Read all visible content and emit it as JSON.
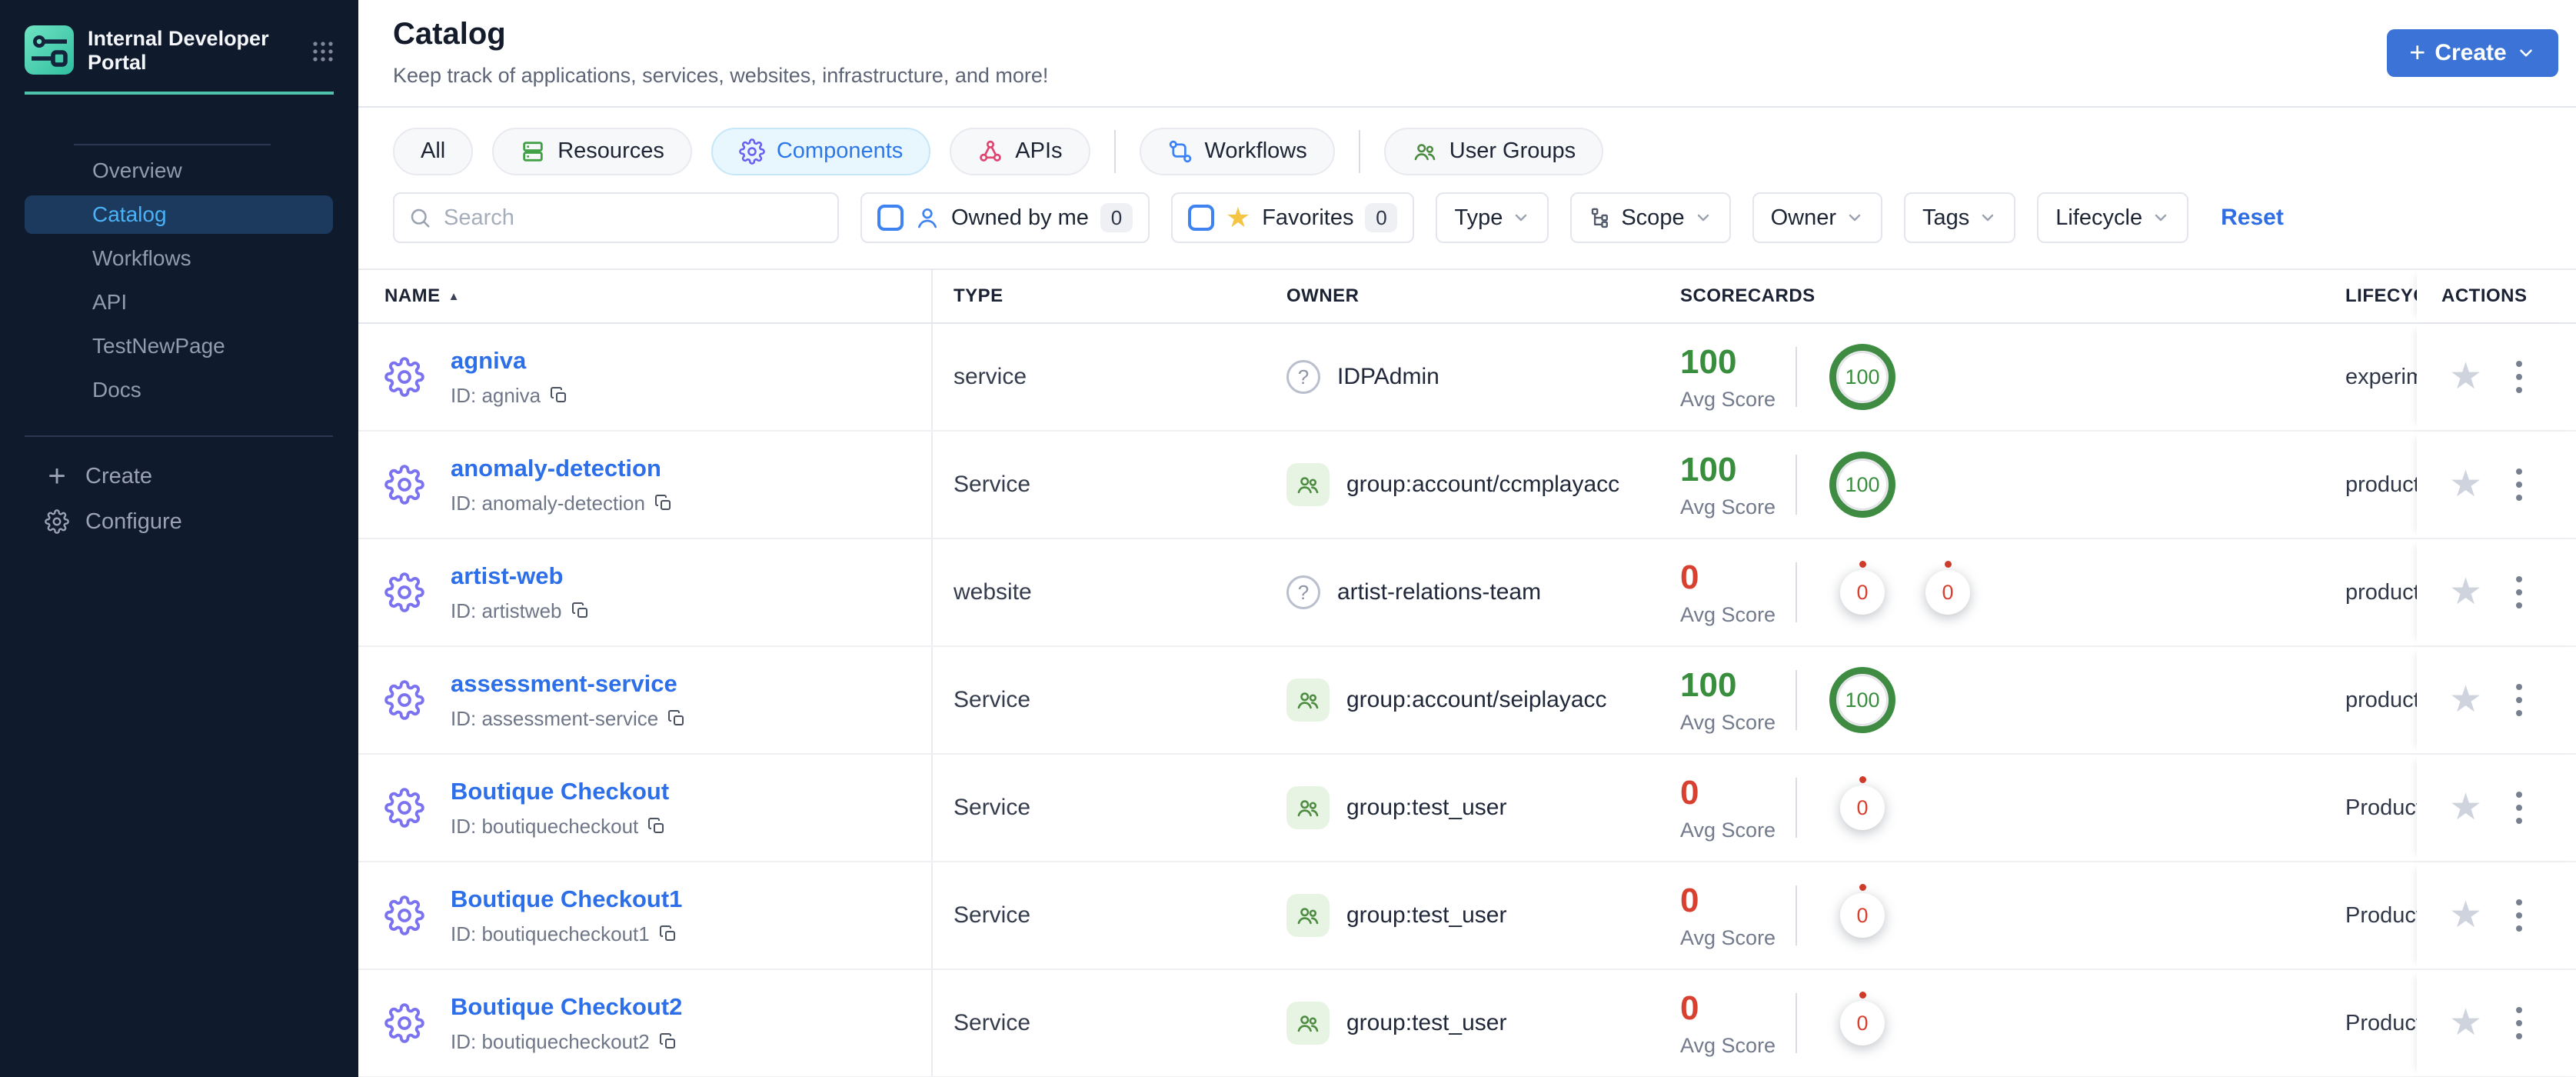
{
  "sidebar": {
    "brand_title": "Internal Developer Portal",
    "nav": {
      "overview": "Overview",
      "catalog": "Catalog",
      "workflows": "Workflows",
      "api": "API",
      "testnewpage": "TestNewPage",
      "docs": "Docs"
    },
    "active_item": "Catalog",
    "create_label": "Create",
    "configure_label": "Configure"
  },
  "header": {
    "title": "Catalog",
    "subtitle": "Keep track of applications, services, websites, infrastructure, and more!",
    "create_button": "Create"
  },
  "tabs": {
    "all": "All",
    "resources": "Resources",
    "components": "Components",
    "apis": "APIs",
    "workflows": "Workflows",
    "user_groups": "User Groups",
    "active_tab": "Components"
  },
  "filters": {
    "search_placeholder": "Search",
    "owned_by_me": {
      "label": "Owned by me",
      "count": "0",
      "checked": false
    },
    "favorites": {
      "label": "Favorites",
      "count": "0",
      "checked": false
    },
    "type_label": "Type",
    "scope_label": "Scope",
    "owner_label": "Owner",
    "tags_label": "Tags",
    "lifecycle_label": "Lifecycle",
    "reset_label": "Reset"
  },
  "table": {
    "headers": {
      "name": "NAME",
      "type": "TYPE",
      "owner": "OWNER",
      "scorecards": "SCORECARDS",
      "lifecycle": "LIFECYCLE",
      "actions": "ACTIONS"
    },
    "sort": {
      "column": "NAME",
      "direction": "ascending"
    },
    "avg_score_label": "Avg Score",
    "rows": [
      {
        "name": "agniva",
        "id_label": "ID: agniva",
        "type": "service",
        "owner": "IDPAdmin",
        "owner_kind": "user",
        "avg_score": "100",
        "score_state": "good",
        "scorecards": [
          "100"
        ],
        "lifecycle": "experimental"
      },
      {
        "name": "anomaly-detection",
        "id_label": "ID: anomaly-detection",
        "type": "Service",
        "owner": "group:account/ccmplayacc",
        "owner_kind": "group",
        "avg_score": "100",
        "score_state": "good",
        "scorecards": [
          "100"
        ],
        "lifecycle": "production"
      },
      {
        "name": "artist-web",
        "id_label": "ID: artistweb",
        "type": "website",
        "owner": "artist-relations-team",
        "owner_kind": "user",
        "avg_score": "0",
        "score_state": "bad",
        "scorecards": [
          "0",
          "0"
        ],
        "lifecycle": "production"
      },
      {
        "name": "assessment-service",
        "id_label": "ID: assessment-service",
        "type": "Service",
        "owner": "group:account/seiplayacc",
        "owner_kind": "group",
        "avg_score": "100",
        "score_state": "good",
        "scorecards": [
          "100"
        ],
        "lifecycle": "production"
      },
      {
        "name": "Boutique Checkout",
        "id_label": "ID: boutiquecheckout",
        "type": "Service",
        "owner": "group:test_user",
        "owner_kind": "group",
        "avg_score": "0",
        "score_state": "bad",
        "scorecards": [
          "0"
        ],
        "lifecycle": "Production"
      },
      {
        "name": "Boutique Checkout1",
        "id_label": "ID: boutiquecheckout1",
        "type": "Service",
        "owner": "group:test_user",
        "owner_kind": "group",
        "avg_score": "0",
        "score_state": "bad",
        "scorecards": [
          "0"
        ],
        "lifecycle": "Production"
      },
      {
        "name": "Boutique Checkout2",
        "id_label": "ID: boutiquecheckout2",
        "type": "Service",
        "owner": "group:test_user",
        "owner_kind": "group",
        "avg_score": "0",
        "score_state": "bad",
        "scorecards": [
          "0"
        ],
        "lifecycle": "Production"
      }
    ]
  },
  "colors": {
    "sidebar_bg": "#0f1b2d",
    "sidebar_active_bg": "#1c3a5e",
    "sidebar_active_text": "#4ab2f7",
    "brand_teal": "#4fc4ad",
    "accent_blue": "#3b74d6",
    "link_blue": "#2d6fe8",
    "active_tab_bg": "#e8f6fd",
    "active_tab_text": "#2d78e8",
    "success_green": "#388e3c",
    "error_red": "#d8402f",
    "favorite_gold": "#f4c542"
  }
}
